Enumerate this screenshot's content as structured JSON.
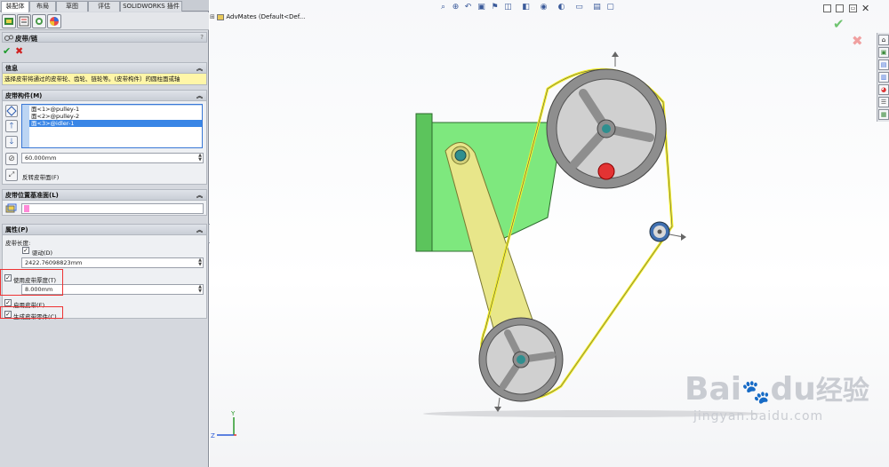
{
  "tabs": [
    "装配体",
    "布局",
    "草图",
    "评估",
    "SOLIDWORKS 插件"
  ],
  "property_manager": {
    "title": "皮带/链",
    "help": "?",
    "ok_icon": "check-icon",
    "cancel_icon": "close-icon"
  },
  "info": {
    "header": "信息",
    "message": "选择皮带将通过的皮带轮、齿轮、链轮等。(皮带构件）的圆柱面或轴"
  },
  "members": {
    "header": "皮带构件(M)",
    "items": [
      "面<1>@pulley-1",
      "面<2>@pulley-2",
      "面<3>@idler-1"
    ],
    "pitch_value": "60.000mm",
    "flip_label": "反转皮带面(F)"
  },
  "plane": {
    "header": "皮带位置基准面(L)"
  },
  "properties": {
    "header": "属性(P)",
    "length_label": "皮带长度:",
    "driving_label": "驱动(D)",
    "length_value": "2422.76098823mm",
    "thickness_label": "使用皮带厚度(T)",
    "thickness_value": "8.000mm",
    "engage_label": "启用皮带(E)",
    "create_part_label": "生成皮带零件(C)"
  },
  "viewport": {
    "tree_label": "AdvMates  (Default<Def..."
  },
  "watermark": {
    "line1": "Bai",
    "line1b": "du",
    "line1c": "经验",
    "line2": "jingyan.baidu.com"
  },
  "colors": {
    "bracket": "#7ee87e",
    "arm": "#e8e68a",
    "pulley": "#9a9a9a",
    "belt": "#f5f02a",
    "accent_red": "#e33333",
    "highlight": "#fff6a8"
  }
}
